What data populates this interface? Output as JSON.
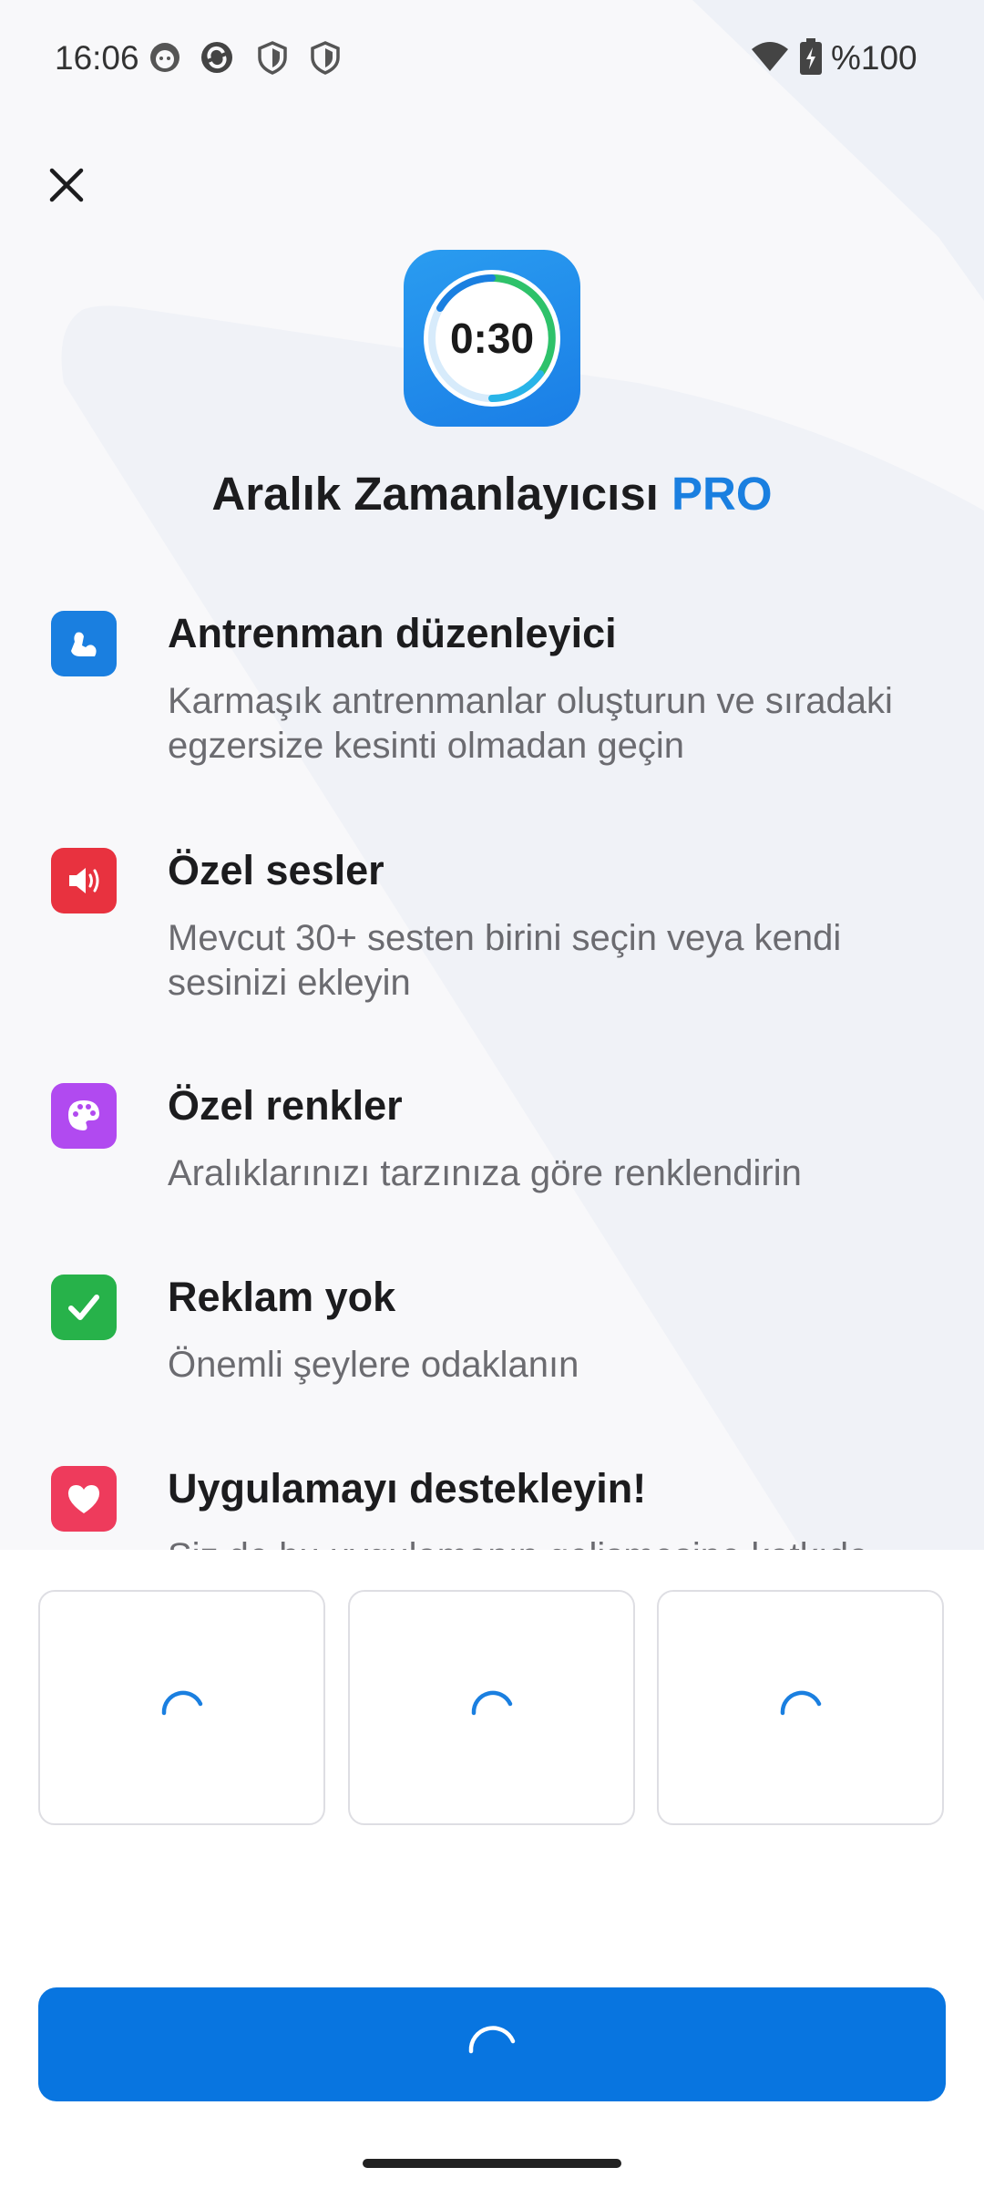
{
  "status_bar": {
    "time": "16:06",
    "left_icons": [
      "face-notification-icon",
      "sync-app-icon",
      "shield-icon",
      "shield-icon"
    ],
    "right_icons": [
      "wifi-icon",
      "battery-charging-icon"
    ],
    "battery": "%100"
  },
  "close_icon": "close-icon",
  "app_icon": {
    "timer": "0:30"
  },
  "title": {
    "main": "Aralık Zamanlayıcısı",
    "pro": "PRO"
  },
  "features": [
    {
      "icon": "muscle-icon",
      "color": "#1a7fe0",
      "title": "Antrenman düzenleyici",
      "desc": "Karmaşık antrenmanlar oluşturun ve sıradaki egzersize kesinti olmadan geçin"
    },
    {
      "icon": "speaker-icon",
      "color": "#e8323f",
      "title": "Özel sesler",
      "desc": "Mevcut 30+ sesten birini seçin veya kendi sesinizi ekleyin"
    },
    {
      "icon": "palette-icon",
      "color": "#b14af0",
      "title": "Özel renkler",
      "desc": "Aralıklarınızı tarzınıza göre renklendirin"
    },
    {
      "icon": "checkmark-icon",
      "color": "#27b24a",
      "title": "Reklam yok",
      "desc": "Önemli şeylere odaklanın"
    },
    {
      "icon": "heart-icon",
      "color": "#ee3b5c",
      "title": "Uygulamayı destekleyin!",
      "desc": "Siz de bu uygulamanın gelişmesine katkıda bulunun"
    }
  ],
  "plans": [
    {
      "state": "loading"
    },
    {
      "state": "loading"
    },
    {
      "state": "loading"
    }
  ],
  "purchase_button": {
    "state": "loading"
  },
  "colors": {
    "accent": "#0875e0",
    "pro": "#1a7fe0"
  }
}
